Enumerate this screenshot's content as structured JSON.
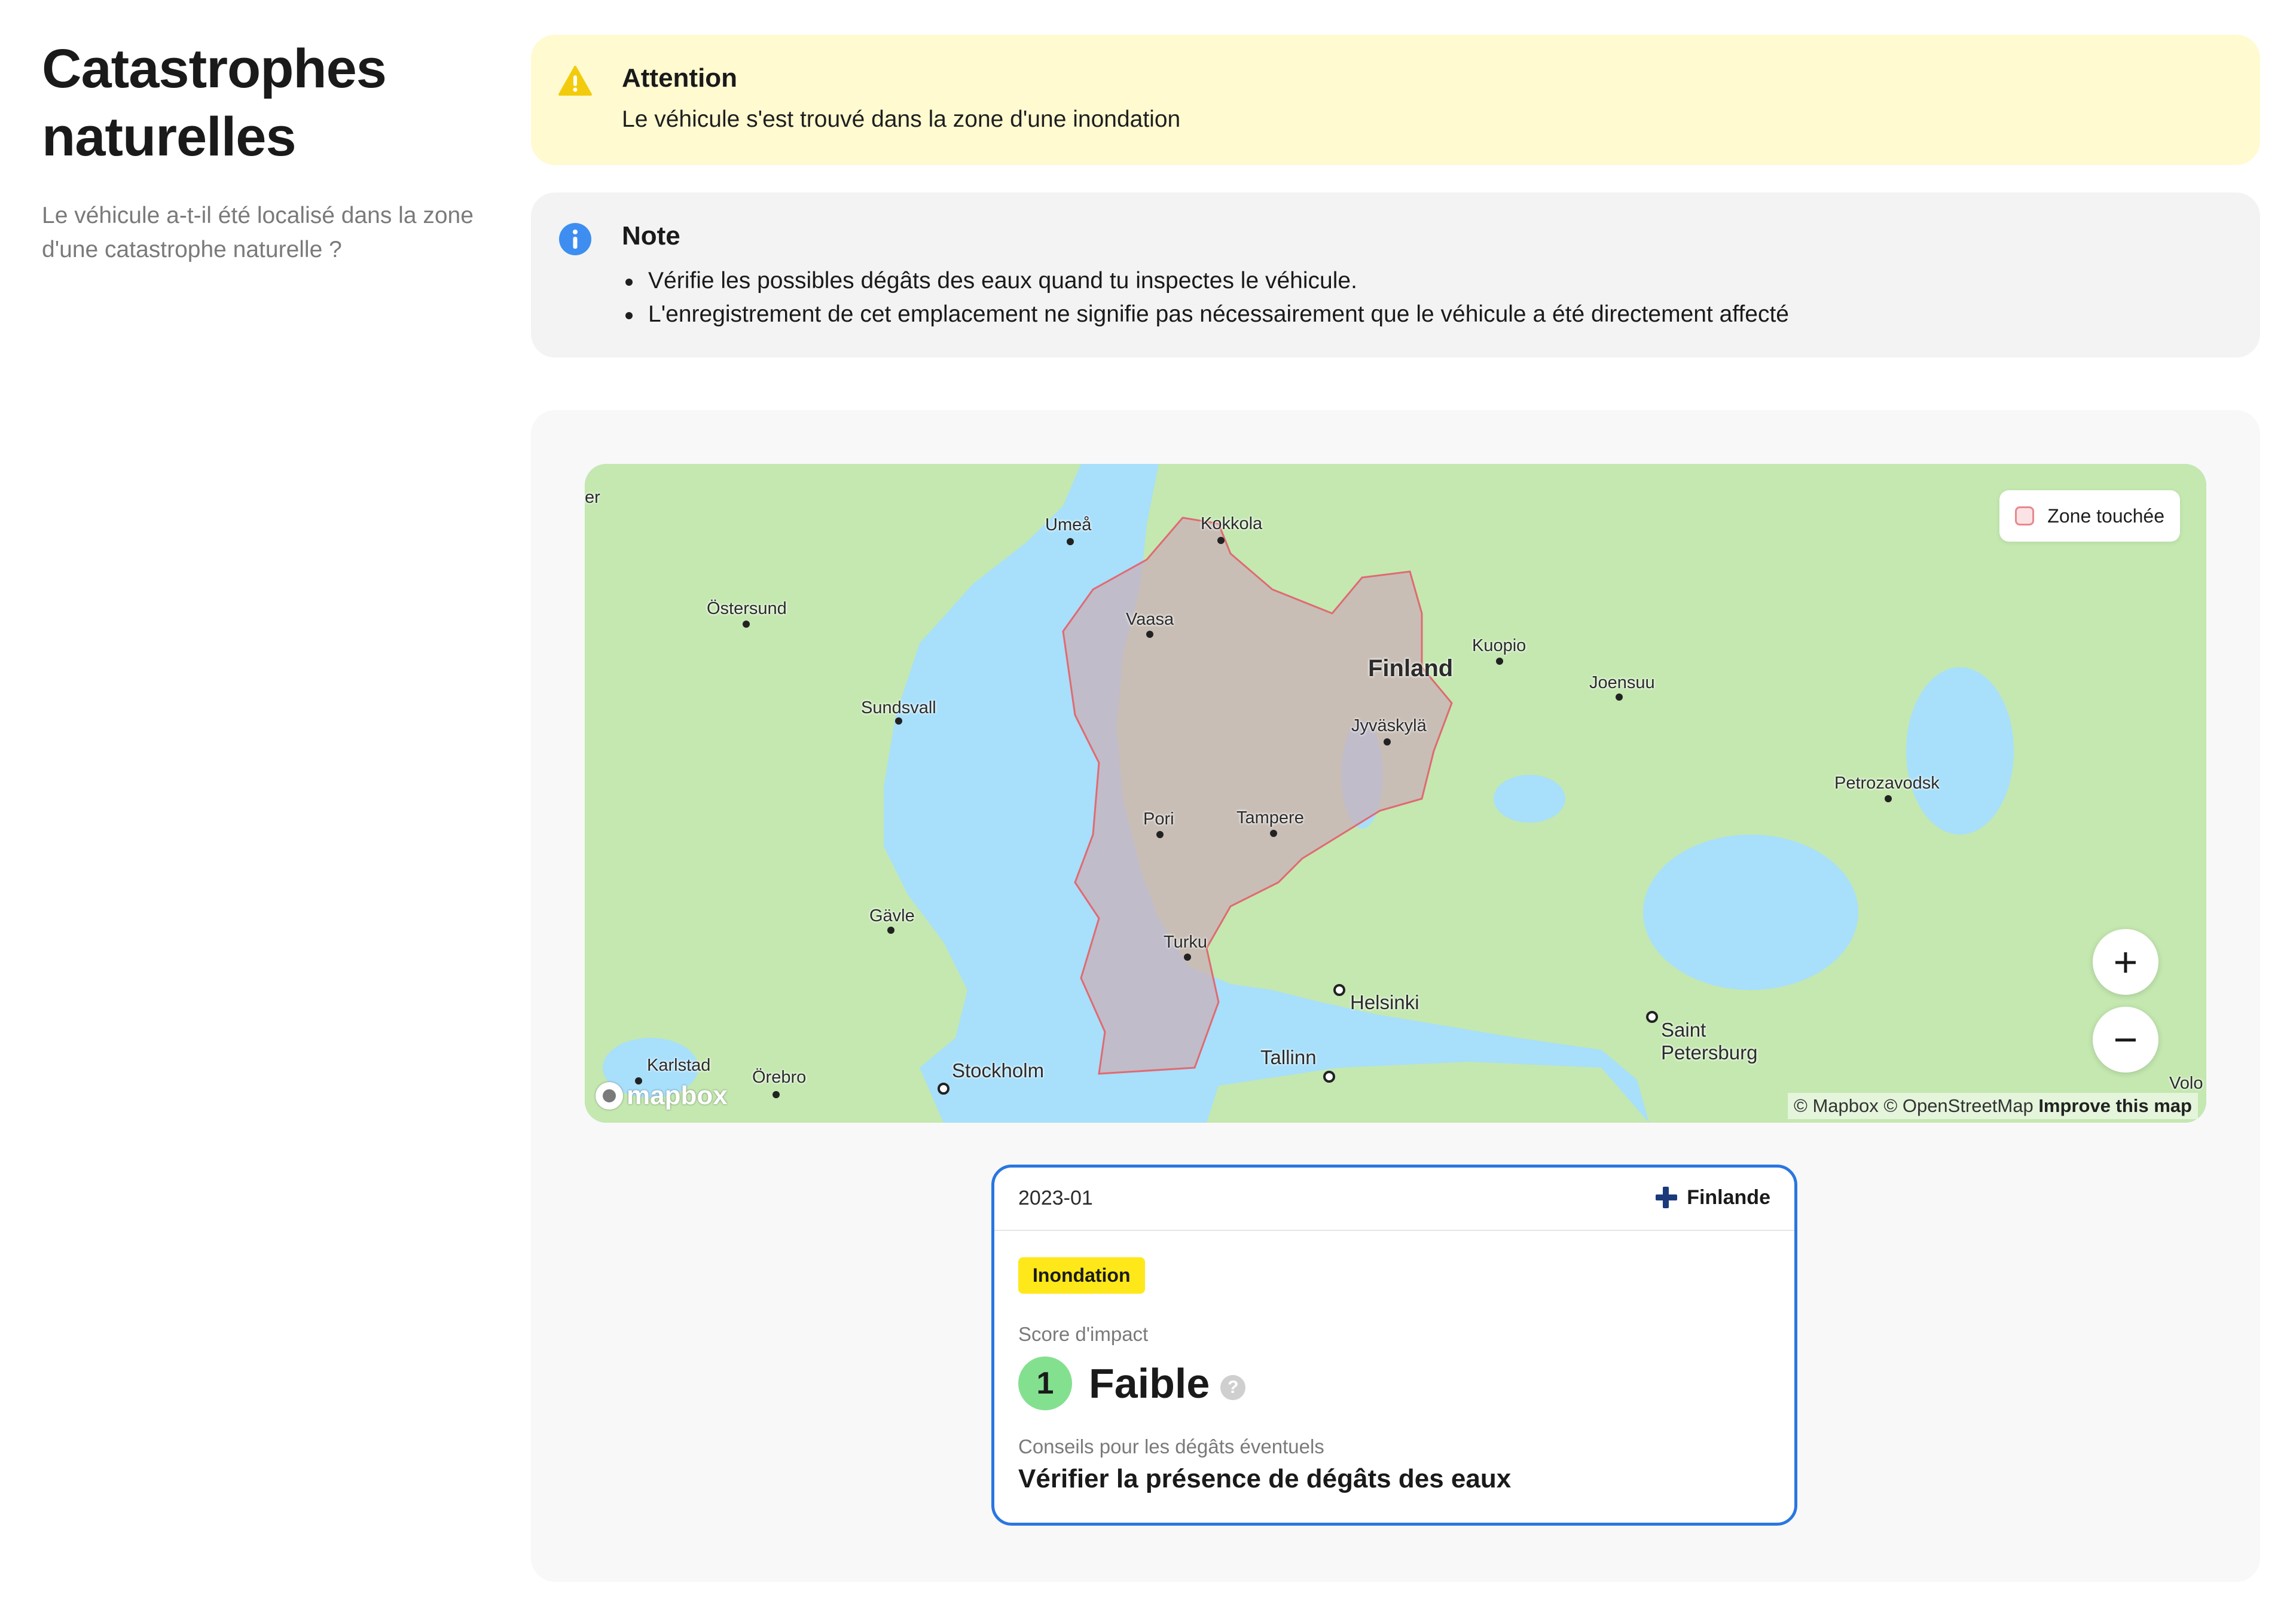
{
  "header": {
    "title": "Catastrophes naturelles",
    "subtitle": "Le véhicule a-t-il été localisé dans la zone d'une catastrophe naturelle ?"
  },
  "warning": {
    "icon": "warning-triangle-icon",
    "title": "Attention",
    "text": "Le véhicule s'est trouvé dans la zone d'une inondation",
    "color": "#fffad0"
  },
  "note": {
    "icon": "info-circle-icon",
    "title": "Note",
    "items": [
      "Vérifie les possibles dégâts des eaux quand tu inspectes le véhicule.",
      "L'enregistrement de cet emplacement ne signifie pas nécessairement que le véhicule a été directement affecté"
    ]
  },
  "map": {
    "legend_label": "Zone touchée",
    "zoom_in": "+",
    "zoom_out": "−",
    "logo": "mapbox",
    "attribution": "© Mapbox © OpenStreetMap",
    "improve_link": "Improve this map",
    "places": {
      "umea": "Umeå",
      "kokkola": "Kokkola",
      "ostersund": "Östersund",
      "vaasa": "Vaasa",
      "kuopio": "Kuopio",
      "finland": "Finland",
      "joensuu": "Joensuu",
      "sundsvall": "Sundsvall",
      "jyvaskyla": "Jyväskylä",
      "petrozavodsk": "Petrozavodsk",
      "pori": "Pori",
      "tampere": "Tampere",
      "gavle": "Gävle",
      "turku": "Turku",
      "helsinki": "Helsinki",
      "saint": "Saint",
      "petersburg": "Petersburg",
      "tallinn": "Tallinn",
      "karlstad": "Karlstad",
      "orebro": "Örebro",
      "stockholm": "Stockholm",
      "er": "er",
      "volo": "Volo"
    },
    "colors": {
      "land": "#c4e8b0",
      "water": "#a8dffa",
      "zone_fill": "#c9b0b8",
      "zone_stroke": "#e06a72"
    }
  },
  "event": {
    "date": "2023-01",
    "country": "Finlande",
    "type": "Inondation",
    "score_label": "Score d'impact",
    "score_value": "1",
    "score_text": "Faible",
    "help": "?",
    "advice_label": "Conseils pour les dégâts éventuels",
    "advice_text": "Vérifier la présence de dégâts des eaux",
    "accent": "#2a76e0",
    "badge_color": "#ffe81a",
    "score_color": "#83e08f"
  }
}
